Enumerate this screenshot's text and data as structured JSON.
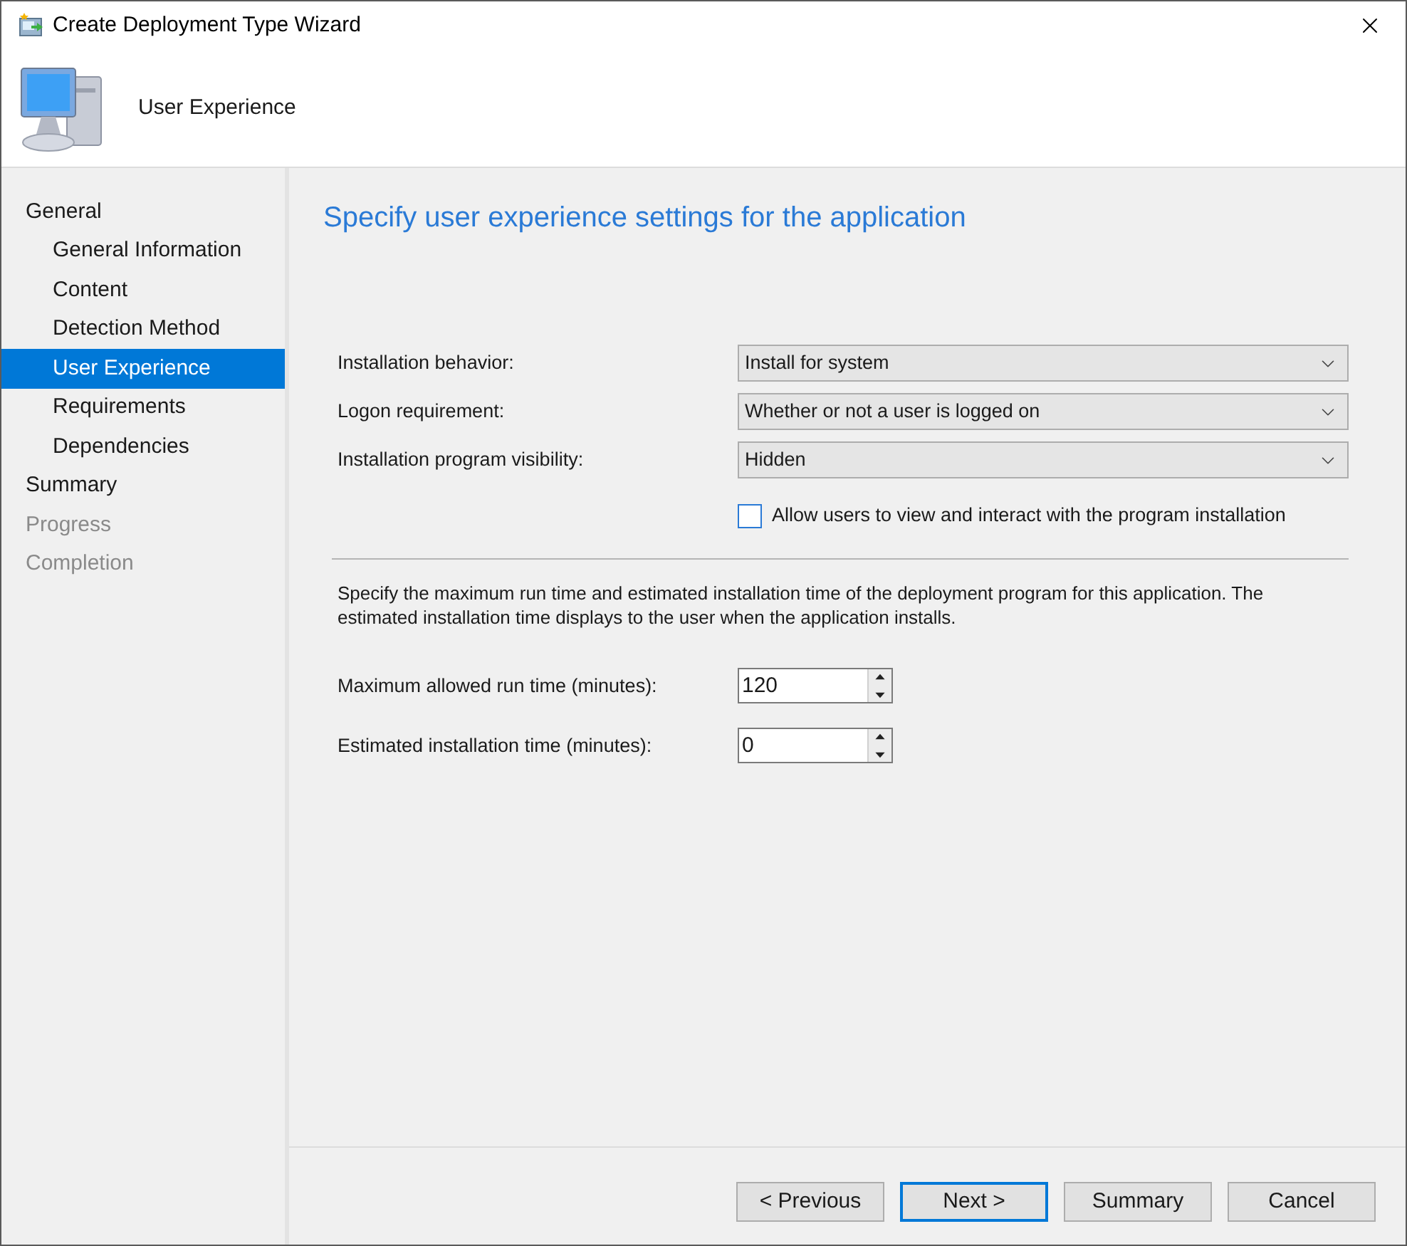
{
  "window": {
    "title": "Create Deployment Type Wizard"
  },
  "header": {
    "title": "User Experience"
  },
  "steps": [
    {
      "label": "General",
      "selected": false,
      "disabled": false,
      "children": [
        {
          "label": "General Information",
          "selected": false,
          "disabled": false
        },
        {
          "label": "Content",
          "selected": false,
          "disabled": false
        },
        {
          "label": "Detection Method",
          "selected": false,
          "disabled": false
        },
        {
          "label": "User Experience",
          "selected": true,
          "disabled": false
        },
        {
          "label": "Requirements",
          "selected": false,
          "disabled": false
        },
        {
          "label": "Dependencies",
          "selected": false,
          "disabled": false
        }
      ]
    },
    {
      "label": "Summary",
      "selected": false,
      "disabled": false
    },
    {
      "label": "Progress",
      "selected": false,
      "disabled": true
    },
    {
      "label": "Completion",
      "selected": false,
      "disabled": true
    }
  ],
  "page": {
    "heading": "Specify user experience settings for the application",
    "dropdowns": [
      {
        "label": "Installation behavior:",
        "value": "Install for system"
      },
      {
        "label": "Logon requirement:",
        "value": "Whether or not a user is logged on"
      },
      {
        "label": "Installation program visibility:",
        "value": "Hidden"
      }
    ],
    "checkbox": {
      "label": "Allow users to view and interact with the program installation",
      "checked": false
    },
    "description": "Specify the maximum run time and estimated installation time of the deployment program for this application. The estimated installation time displays to the user when the application installs.",
    "spinners": [
      {
        "label": "Maximum allowed run time (minutes):",
        "value": "120"
      },
      {
        "label": "Estimated installation time (minutes):",
        "value": "0"
      }
    ]
  },
  "buttons": [
    {
      "label": "< Previous",
      "default": false
    },
    {
      "label": "Next >",
      "default": true
    },
    {
      "label": "Summary",
      "default": false
    },
    {
      "label": "Cancel",
      "default": false
    }
  ]
}
